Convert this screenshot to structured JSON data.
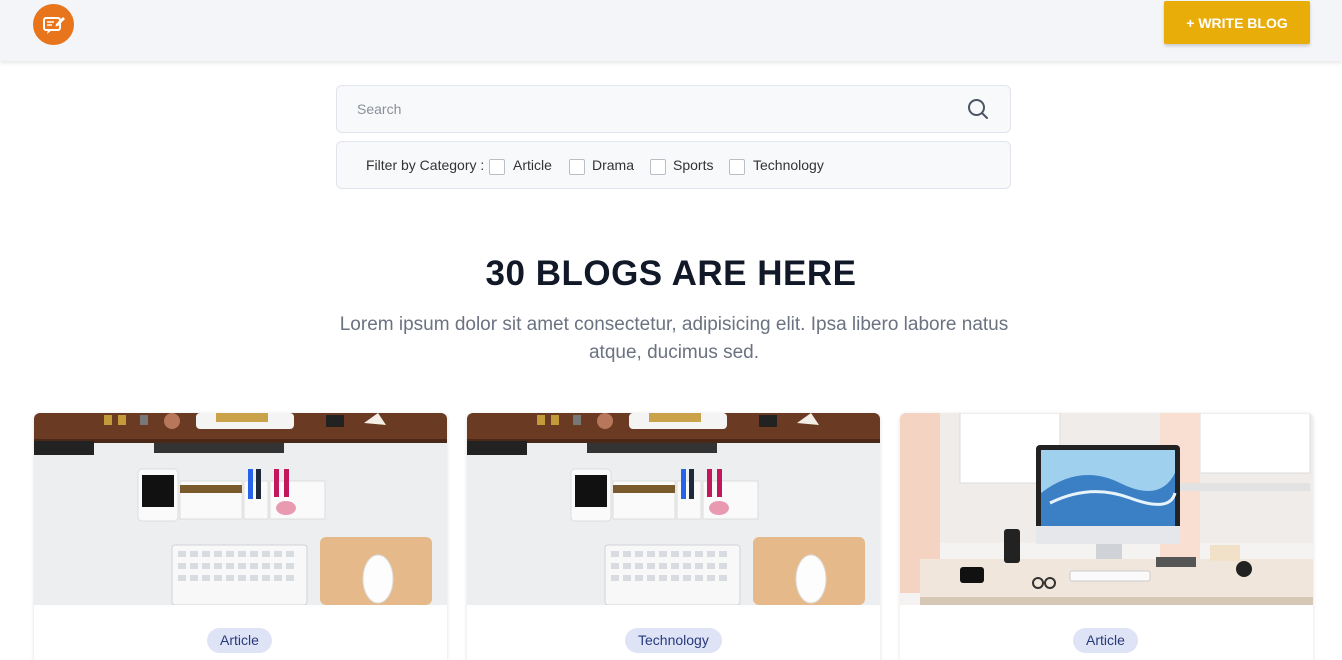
{
  "header": {
    "logo_icon": "blog-chat-edit-icon",
    "write_button_label": "+ WRITE BLOG",
    "brand_color": "#e8741b",
    "button_color": "#e9ad0a"
  },
  "search": {
    "placeholder": "Search",
    "value": "",
    "icon": "search-icon"
  },
  "filter": {
    "label": "Filter by Category :",
    "options": [
      {
        "label": "Article",
        "checked": false
      },
      {
        "label": "Drama",
        "checked": false
      },
      {
        "label": "Sports",
        "checked": false
      },
      {
        "label": "Technology",
        "checked": false
      }
    ]
  },
  "main": {
    "heading": "30 BLOGS ARE HERE",
    "subtitle": "Lorem ipsum dolor sit amet consectetur, adipisicing elit. Ipsa libero labore natus atque, ducimus sed."
  },
  "cards": [
    {
      "image": "desk-flatlay-photo",
      "category": "Article"
    },
    {
      "image": "desk-flatlay-photo",
      "category": "Technology"
    },
    {
      "image": "imac-workspace-photo",
      "category": "Article"
    }
  ]
}
